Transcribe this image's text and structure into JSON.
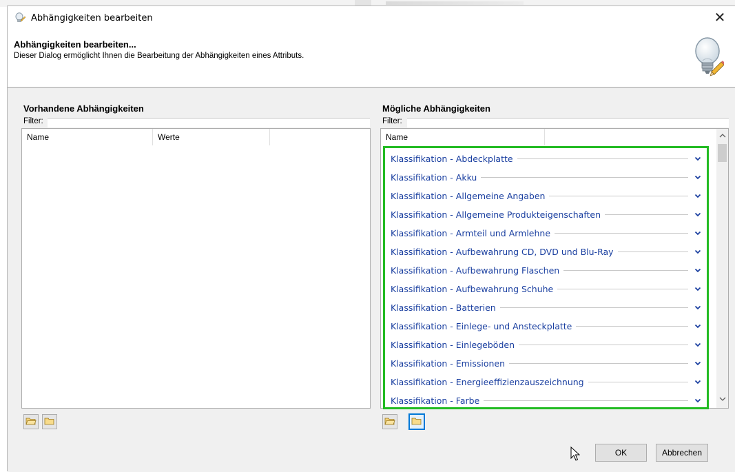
{
  "window": {
    "title": "Abhängigkeiten bearbeiten",
    "close_glyph": "✕",
    "title_icon": "lightbulb-icon"
  },
  "header": {
    "title": "Abhängigkeiten bearbeiten...",
    "description": "Dieser Dialog ermöglicht Ihnen die Bearbeitung der Abhängigkeiten eines Attributs.",
    "icon": "lightbulb-pencil-icon"
  },
  "left_panel": {
    "title": "Vorhandene Abhängigkeiten",
    "filter_label": "Filter:",
    "filter_value": "",
    "columns": [
      "Name",
      "Werte"
    ],
    "rows": []
  },
  "right_panel": {
    "title": "Mögliche Abhängigkeiten",
    "filter_label": "Filter:",
    "filter_value": "",
    "columns": [
      "Name"
    ],
    "rows": [
      "Klassifikation - Abdeckplatte",
      "Klassifikation - Akku",
      "Klassifikation - Allgemeine Angaben",
      "Klassifikation - Allgemeine Produkteigenschaften",
      "Klassifikation - Armteil und Armlehne",
      "Klassifikation - Aufbewahrung CD, DVD und Blu-Ray",
      "Klassifikation - Aufbewahrung Flaschen",
      "Klassifikation - Aufbewahrung Schuhe",
      "Klassifikation - Batterien",
      "Klassifikation - Einlege- und Ansteckplatte",
      "Klassifikation - Einlegeböden",
      "Klassifikation - Emissionen",
      "Klassifikation - Energieeffizienzauszeichnung",
      "Klassifikation - Farbe"
    ],
    "highlight_color": "#22bb22",
    "row_text_color": "#1a3fa0"
  },
  "buttons": {
    "ok": "OK",
    "cancel": "Abbrechen"
  },
  "colors": {
    "dialog_bg": "#f0f0f0",
    "focus_border": "#0078d7"
  }
}
